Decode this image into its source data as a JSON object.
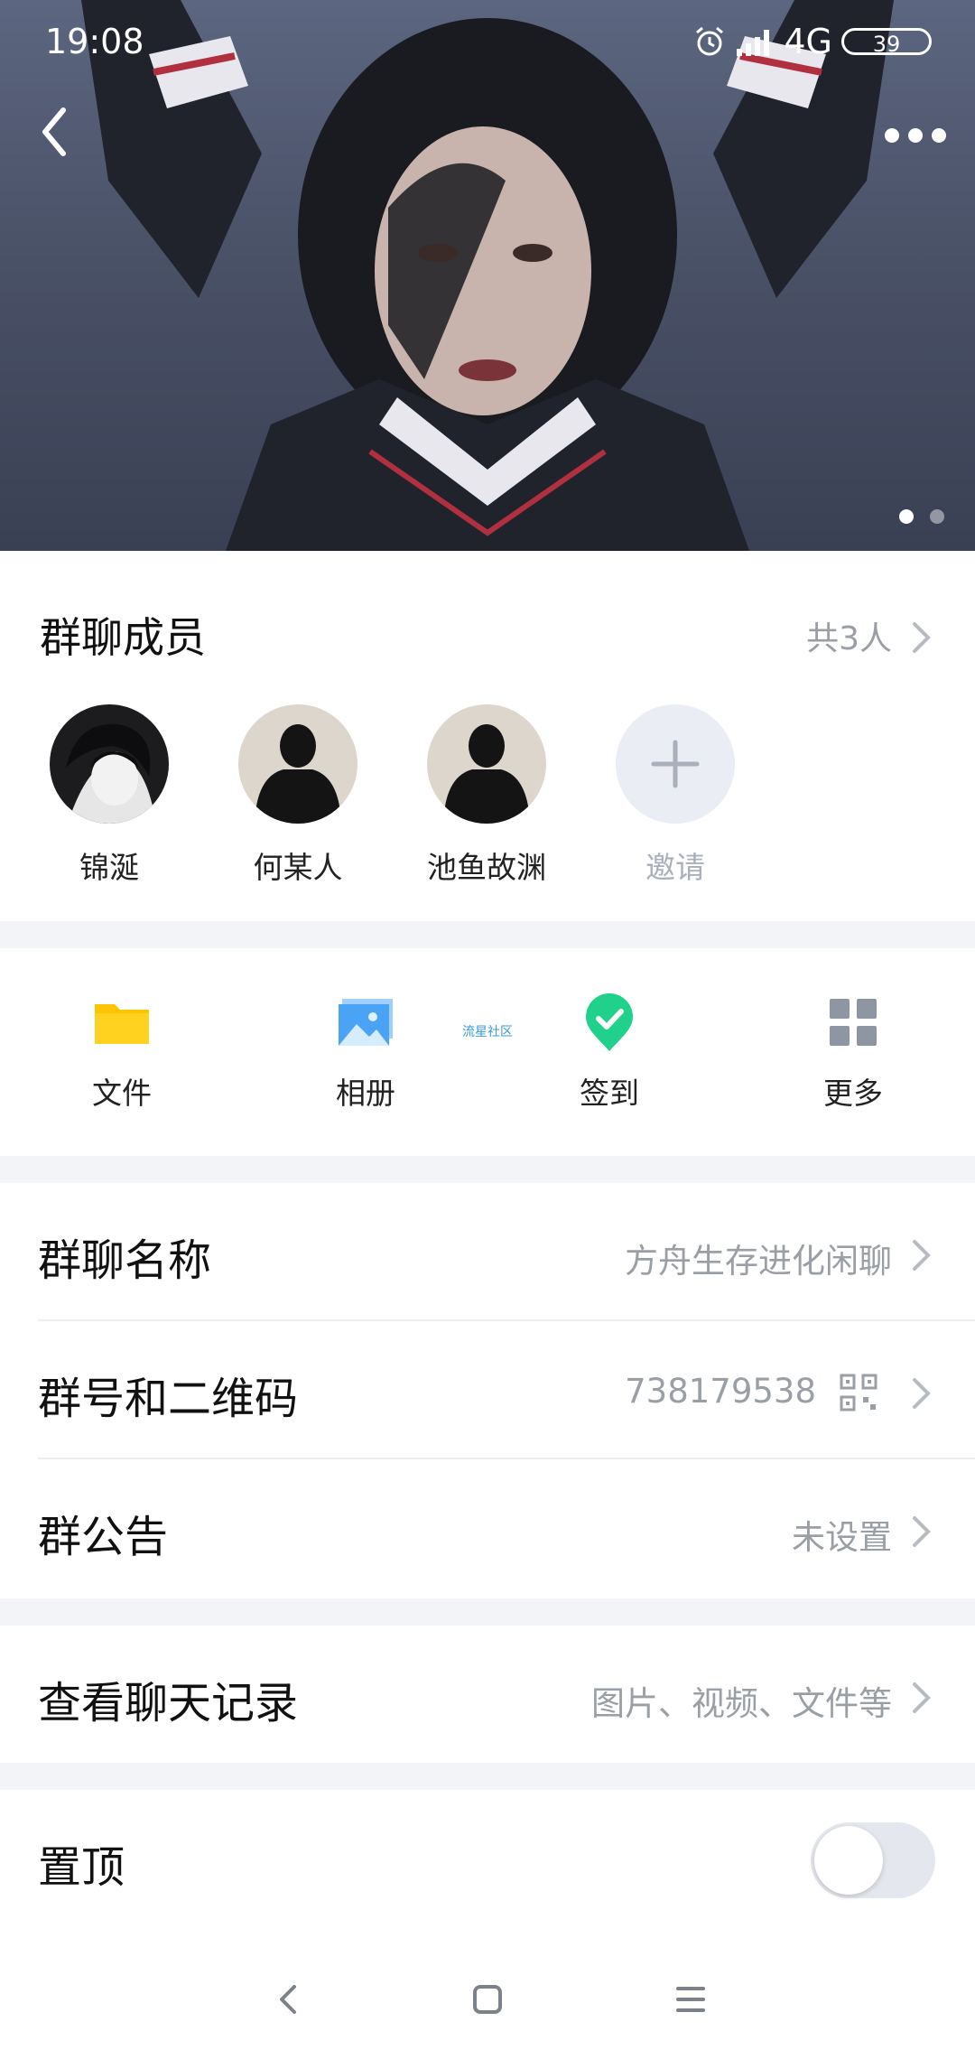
{
  "status_bar": {
    "time": "19:08",
    "network": "4G",
    "battery": "39"
  },
  "hero": {
    "page_dots": {
      "count": 2,
      "active_index": 0
    }
  },
  "members": {
    "title": "群聊成员",
    "count_label": "共3人",
    "items": [
      {
        "name": "锦涎"
      },
      {
        "name": "何某人"
      },
      {
        "name": "池鱼故渊"
      }
    ],
    "invite_label": "邀请"
  },
  "tools": {
    "items": [
      {
        "label": "文件",
        "icon": "folder-icon"
      },
      {
        "label": "相册",
        "icon": "album-icon"
      },
      {
        "label": "签到",
        "icon": "checkin-icon"
      },
      {
        "label": "更多",
        "icon": "grid-icon"
      }
    ],
    "watermark": "流星社区"
  },
  "settings": {
    "group_name": {
      "label": "群聊名称",
      "value": "方舟生存进化闲聊"
    },
    "group_id": {
      "label": "群号和二维码",
      "value": "738179538"
    },
    "announcement": {
      "label": "群公告",
      "value": "未设置"
    },
    "history": {
      "label": "查看聊天记录",
      "value": "图片、视频、文件等"
    },
    "pin": {
      "label": "置顶",
      "enabled": false
    }
  },
  "colors": {
    "accent_green": "#1fd18a",
    "folder_yellow": "#ffc400",
    "album_blue": "#4aa3f5",
    "grey_text": "#9a9fa6"
  }
}
